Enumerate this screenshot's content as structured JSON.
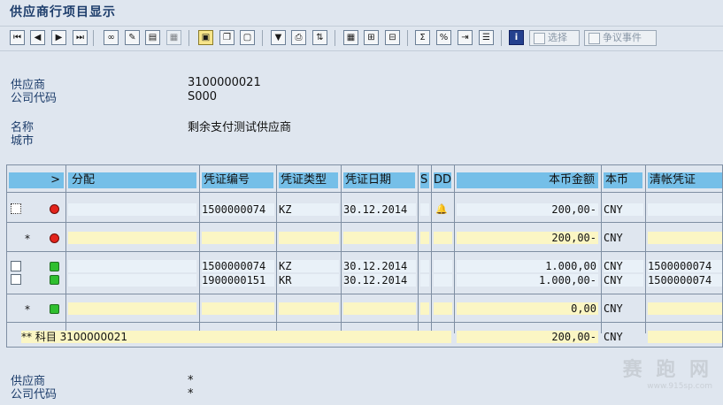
{
  "window": {
    "title": "供应商行项目显示"
  },
  "toolbar": {
    "select_label": "选择",
    "dispute_label": "争议事件",
    "icons": [
      "first-page-icon",
      "prev-page-icon",
      "next-page-icon",
      "last-page-icon",
      "glasses-icon",
      "pencil-icon",
      "columns-icon",
      "disabled-calc-icon",
      "select-layout-icon",
      "copy-icon",
      "document-icon",
      "filter-icon",
      "print-icon",
      "sort-icon",
      "grid-icon",
      "grid-plus-icon",
      "grid-delete-icon",
      "sum-icon",
      "subtotal-icon",
      "export-icon",
      "layout-icon",
      "info-icon"
    ]
  },
  "header": {
    "vendor_label": "供应商",
    "vendor_value": "3100000021",
    "company_code_label": "公司代码",
    "company_code_value": "S000",
    "name_label": "名称",
    "name_value": "剩余支付测试供应商",
    "city_label": "城市",
    "city_value": ""
  },
  "table": {
    "columns": [
      "分配",
      "凭证编号",
      "凭证类型",
      "凭证日期",
      "S",
      "DD",
      "本币金额",
      "本币",
      "清帐凭证"
    ],
    "rows": [
      {
        "doc_no": "1500000074",
        "type": "KZ",
        "date": "30.12.2014",
        "amount": "200,00-",
        "currency": "CNY",
        "clearing": ""
      },
      {
        "subtotal": "200,00-",
        "currency": "CNY",
        "star": "*"
      },
      {
        "doc_no": "1500000074",
        "type": "KZ",
        "date": "30.12.2014",
        "amount": "1.000,00",
        "currency": "CNY",
        "clearing": "1500000074"
      },
      {
        "doc_no": "1900000151",
        "type": "KR",
        "date": "30.12.2014",
        "amount": "1.000,00-",
        "currency": "CNY",
        "clearing": "1500000074"
      },
      {
        "subtotal": "0,00",
        "currency": "CNY",
        "star": "*"
      },
      {
        "total_label": "** 科目 3100000021",
        "total": "200,00-",
        "currency": "CNY"
      }
    ]
  },
  "footer": {
    "vendor_label": "供应商",
    "vendor_value": "*",
    "company_code_label": "公司代码",
    "company_code_value": "*"
  },
  "watermark": {
    "text": "赛 跑 网",
    "url": "www.915sp.com"
  }
}
